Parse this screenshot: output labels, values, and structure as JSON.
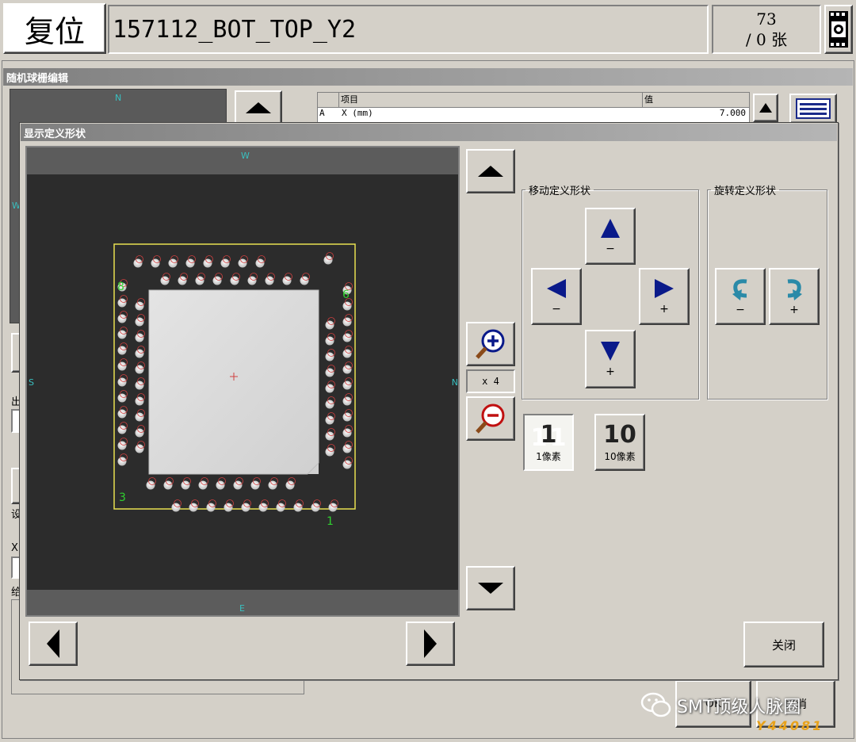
{
  "top_bar": {
    "reset_label": "复位",
    "program_name": "157112_BOT_TOP_Y2",
    "counter_top": "73",
    "counter_bottom": "/ 0 张"
  },
  "bg_window": {
    "title": "随机球栅编辑",
    "compass_n": "N",
    "compass_w": "W",
    "table_headers": [
      "项目",
      "值"
    ],
    "table_row": {
      "col0": "A",
      "col1": "X (mm)",
      "col2": "7.000"
    },
    "side_labels": [
      "出",
      "设",
      "X",
      "给"
    ],
    "ok_label": "OK",
    "cancel_label": "取消"
  },
  "dialog": {
    "title": "显示定义形状",
    "compass": {
      "top": "W",
      "bottom": "E",
      "left": "S",
      "right": "N"
    },
    "pin_labels": {
      "p1": "1",
      "p2": "6",
      "p3": "8",
      "p4": "3"
    },
    "zoom_label": "x 4",
    "move_group_label": "移动定义形状",
    "rotate_group_label": "旋转定义形状",
    "move_up_sign": "−",
    "move_down_sign": "+",
    "move_left_sign": "−",
    "move_right_sign": "+",
    "rotate_ccw_sign": "−",
    "rotate_cw_sign": "+",
    "step1_number": "1",
    "step1_label": "1像素",
    "step10_number": "10",
    "step10_label": "10像素",
    "close_label": "关闭"
  },
  "watermark": {
    "text": "SMT顶级人脉圈",
    "id": "Y44081"
  },
  "colors": {
    "face": "#d4d0c8",
    "title_gradient_start": "#808080",
    "arrow_blue": "#0a1a8a",
    "rotate_teal": "#2a8aa8",
    "outline_yellow": "#e8e050",
    "pad_outline_red": "#d04040",
    "pin_label_green": "#30d030",
    "compass_cyan": "#39c0c0"
  }
}
